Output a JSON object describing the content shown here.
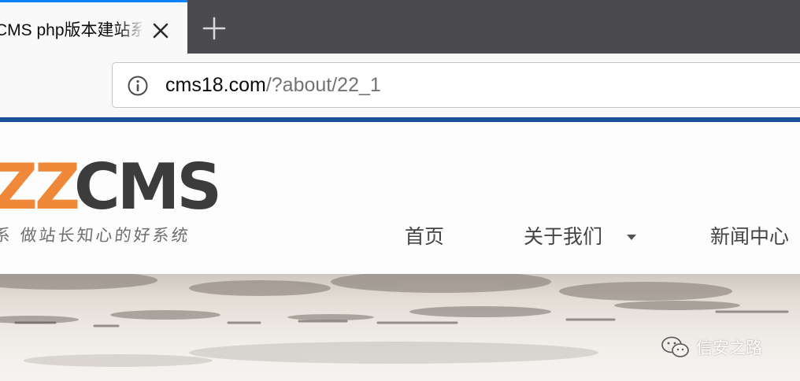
{
  "browser": {
    "tab": {
      "title": "CMS php版本建站系统",
      "close_icon": "close-icon",
      "accent": "#0a84ff"
    },
    "new_tab_icon": "plus-icon",
    "url_bar": {
      "info_icon": "info-icon",
      "host": "cms18.com",
      "path": "/?about/22_1"
    }
  },
  "site": {
    "logo": {
      "part1": "ZZ",
      "part2": "CMS",
      "colors": {
        "orange": "#f0883a",
        "dark": "#3c3c3c"
      }
    },
    "slogan": "系 做站长知心的好系统",
    "nav": {
      "home": "首页",
      "about": "关于我们",
      "news": "新闻中心",
      "about_caret_icon": "caret-down-icon"
    },
    "banner_theme": "ink-wash-landscape"
  },
  "watermark": {
    "icon": "wechat-icon",
    "text": "信安之路"
  }
}
